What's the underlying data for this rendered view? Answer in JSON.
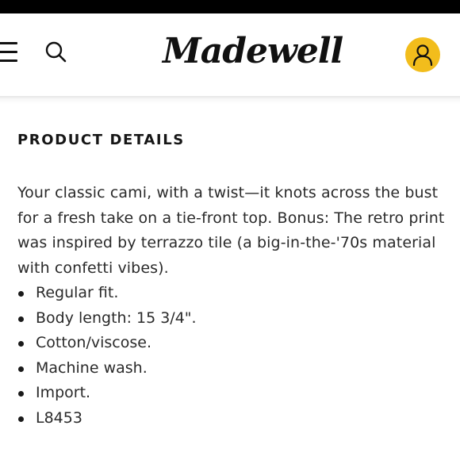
{
  "header": {
    "brand": "Madewell",
    "menu_icon": "hamburger-menu-icon",
    "search_icon": "search-icon",
    "account_icon": "user-icon",
    "account_color": "#f2bd1c"
  },
  "product_details": {
    "title": "PRODUCT DETAILS",
    "description": "Your classic cami, with a twist—it knots across the bust for a fresh take on a tie-front top. Bonus: The retro print was inspired by terrazzo tile (a big-in-the-'70s material with confetti vibes).",
    "items": [
      "Regular fit.",
      "Body length: 15 3/4\".",
      "Cotton/viscose.",
      "Machine wash.",
      "Import.",
      "L8453"
    ]
  }
}
